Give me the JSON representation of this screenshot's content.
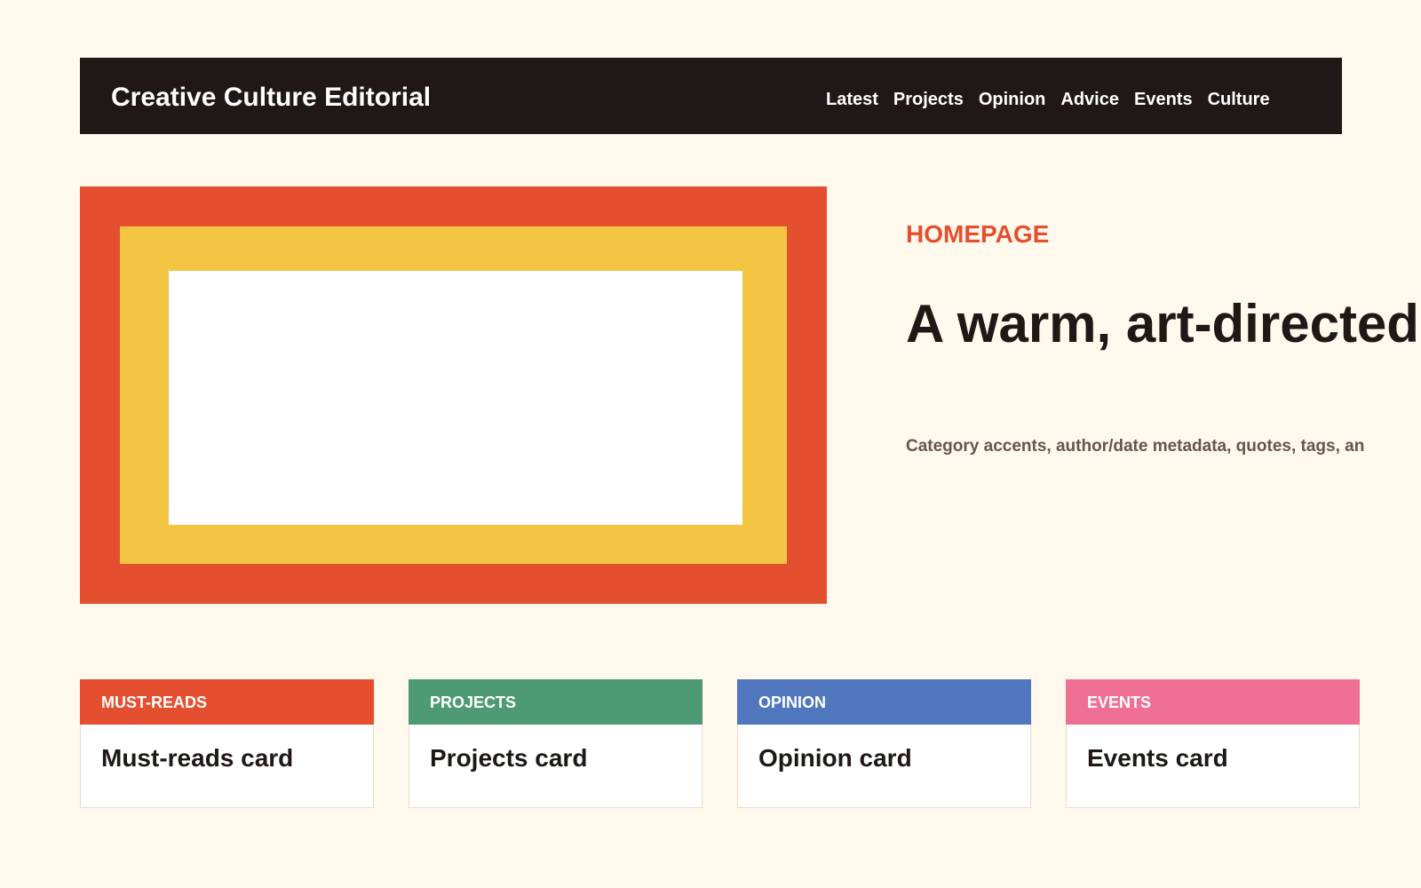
{
  "header": {
    "brand": "Creative Culture Editorial",
    "nav": [
      "Latest",
      "Projects",
      "Opinion",
      "Advice",
      "Events",
      "Culture"
    ]
  },
  "hero": {
    "kicker": "HOMEPAGE",
    "headline": "A warm, art-directed j",
    "dek": "Category accents, author/date metadata, quotes, tags, an",
    "colors": {
      "outer": "#e4502f",
      "middle": "#f4c443",
      "inner": "#ffffff"
    }
  },
  "cards": [
    {
      "category": "MUST-READS",
      "title": "Must-reads card",
      "color": "#e4502f"
    },
    {
      "category": "PROJECTS",
      "title": "Projects card",
      "color": "#4e9a74"
    },
    {
      "category": "OPINION",
      "title": "Opinion card",
      "color": "#5077bd"
    },
    {
      "category": "EVENTS",
      "title": "Events card",
      "color": "#ef7094"
    }
  ],
  "theme": {
    "background": "#fff8ec",
    "header_background": "#201717",
    "text_dark": "#201717",
    "text_muted": "#665550"
  }
}
